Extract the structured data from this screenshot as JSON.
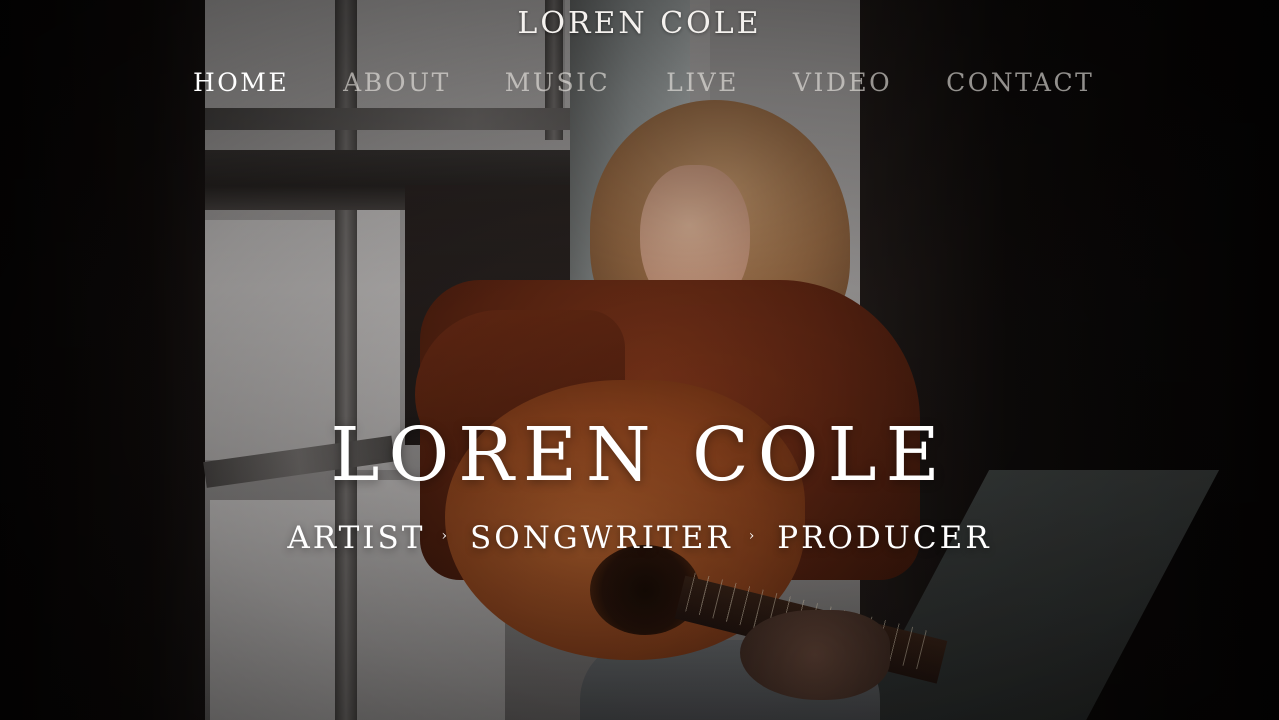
{
  "header": {
    "site_title": "LOREN COLE"
  },
  "nav": {
    "items": [
      {
        "label": "HOME",
        "active": true
      },
      {
        "label": "ABOUT",
        "active": false
      },
      {
        "label": "MUSIC",
        "active": false
      },
      {
        "label": "LIVE",
        "active": false
      },
      {
        "label": "VIDEO",
        "active": false
      },
      {
        "label": "CONTACT",
        "active": false
      }
    ]
  },
  "hero": {
    "title": "LOREN COLE",
    "roles": [
      "ARTIST",
      "SONGWRITER",
      "PRODUCER"
    ],
    "separator": "›"
  },
  "colors": {
    "text": "#ffffff",
    "nav_inactive": "#f0ece8",
    "sweater": "#6a2b14",
    "guitar": "#a0522a",
    "background": "#0b0807"
  }
}
